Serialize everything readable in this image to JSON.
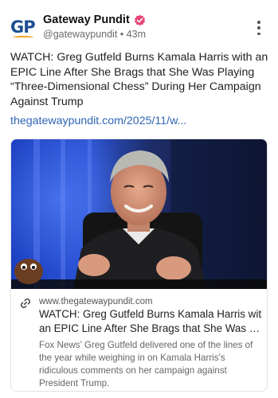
{
  "author": {
    "avatar_text": "GP",
    "name": "Gateway Pundit",
    "handle": "@gatewaypundit",
    "separator": "•",
    "time": "43m"
  },
  "post": {
    "text": "WATCH: Greg Gutfeld Burns Kamala Harris with an EPIC Line After She Brags that She Was Playing “Three-Dimensional Chess” During Her Campaign Against Trump",
    "link": "thegatewaypundit.com/2025/11/w..."
  },
  "card": {
    "domain": "www.thegatewaypundit.com",
    "title_line1": "WATCH: Greg Gutfeld Burns Kamala Harris with",
    "title_line2": "an EPIC Line After She Brags that She Was Pla...",
    "description": "Fox News’ Greg Gutfeld delivered one of the lines of the year while weighing in on Kamala Harris’s ridiculous comments on her campaign against President Trump."
  },
  "icons": {
    "verified": "verified-badge-icon",
    "menu": "more-vertical-icon",
    "link": "link-icon"
  },
  "colors": {
    "brand_blue": "#1d4f91",
    "link_blue": "#2f66b5",
    "verified_pink": "#e8467a"
  }
}
